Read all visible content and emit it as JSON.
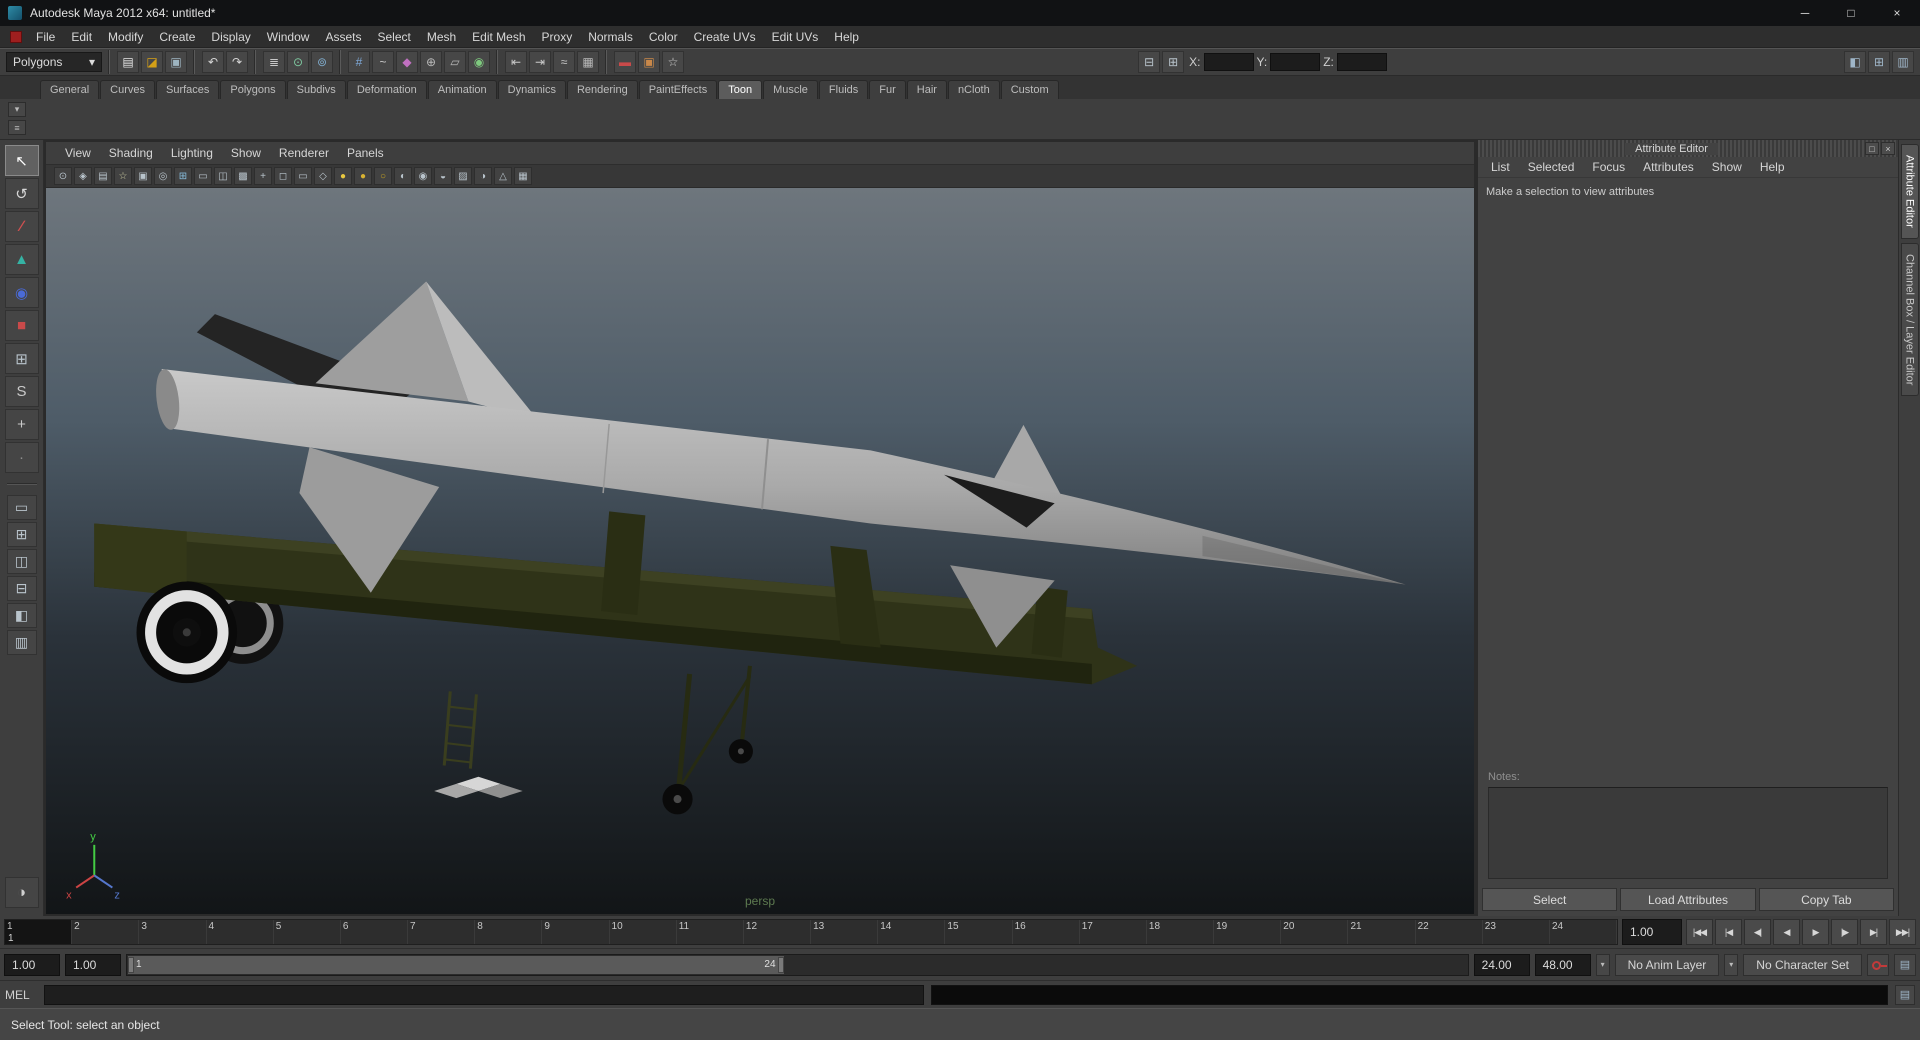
{
  "window": {
    "title": "Autodesk Maya 2012 x64: untitled*",
    "controls": {
      "minimize": "─",
      "maximize": "□",
      "close": "×"
    }
  },
  "menu_bar": {
    "items": [
      {
        "label": "File",
        "name": "menu-file"
      },
      {
        "label": "Edit",
        "name": "menu-edit"
      },
      {
        "label": "Modify",
        "name": "menu-modify"
      },
      {
        "label": "Create",
        "name": "menu-create"
      },
      {
        "label": "Display",
        "name": "menu-display"
      },
      {
        "label": "Window",
        "name": "menu-window"
      },
      {
        "label": "Assets",
        "name": "menu-assets"
      },
      {
        "label": "Select",
        "name": "menu-select"
      },
      {
        "label": "Mesh",
        "name": "menu-mesh"
      },
      {
        "label": "Edit Mesh",
        "name": "menu-edit-mesh"
      },
      {
        "label": "Proxy",
        "name": "menu-proxy"
      },
      {
        "label": "Normals",
        "name": "menu-normals"
      },
      {
        "label": "Color",
        "name": "menu-color"
      },
      {
        "label": "Create UVs",
        "name": "menu-create-uvs"
      },
      {
        "label": "Edit UVs",
        "name": "menu-edit-uvs"
      },
      {
        "label": "Help",
        "name": "menu-help"
      }
    ]
  },
  "status_line": {
    "mode": "Polygons",
    "dropdown_arrow": "▾",
    "file_icons": [
      {
        "name": "new-scene-icon",
        "glyph": "▤",
        "css": "color:#e4e4e4"
      },
      {
        "name": "open-scene-icon",
        "glyph": "◪",
        "css": "color:#d4a017"
      },
      {
        "name": "save-scene-icon",
        "glyph": "▣",
        "css": "color:#9db4c0"
      }
    ],
    "undo_icons": [
      {
        "name": "undo-icon",
        "glyph": "↶",
        "css": "color:#d6d6d6"
      },
      {
        "name": "redo-icon",
        "glyph": "↷",
        "css": "color:#d6d6d6"
      }
    ],
    "select_icons": [
      {
        "name": "select-hierarchy-icon",
        "glyph": "≣",
        "css": "color:#c9c9c9"
      },
      {
        "name": "select-object-icon",
        "glyph": "⊙",
        "css": "color:#7ec9a0"
      },
      {
        "name": "select-component-icon",
        "glyph": "⊚",
        "css": "color:#7ea9c9"
      }
    ],
    "snap_icons": [
      {
        "name": "snap-to-grid-icon",
        "glyph": "#",
        "css": "color:#7ea9d9"
      },
      {
        "name": "snap-to-curve-icon",
        "glyph": "~",
        "css": "color:#c9c9c9"
      },
      {
        "name": "snap-to-point-icon",
        "glyph": "◆",
        "css": "color:#c070c0"
      },
      {
        "name": "snap-to-projected-center-icon",
        "glyph": "⊕",
        "css": "color:#b9b9b9"
      },
      {
        "name": "snap-to-view-plane-icon",
        "glyph": "▱",
        "css": "color:#b9b9b9"
      },
      {
        "name": "make-live-icon",
        "glyph": "◉",
        "css": "color:#7ec97e"
      }
    ],
    "history_icons": [
      {
        "name": "input-connections-icon",
        "glyph": "⇤",
        "css": "color:#c9c9c9"
      },
      {
        "name": "output-connections-icon",
        "glyph": "⇥",
        "css": "color:#c9c9c9"
      },
      {
        "name": "construction-history-icon",
        "glyph": "≈",
        "css": "color:#c9c9c9"
      },
      {
        "name": "hypershade-icon",
        "glyph": "▦",
        "css": "color:#b9b9b9"
      }
    ],
    "render_icons": [
      {
        "name": "render-current-frame-icon",
        "glyph": "▬",
        "css": "color:#c94a4a"
      },
      {
        "name": "ipr-render-icon",
        "glyph": "▣",
        "css": "color:#c9884a"
      },
      {
        "name": "render-settings-icon",
        "glyph": "☆",
        "css": "color:#d6d6d6"
      }
    ],
    "mask_icons": [
      {
        "name": "selection-mask-icon",
        "glyph": "⊟",
        "css": "color:#b9c4cc"
      },
      {
        "name": "input-field-mode-icon",
        "glyph": "⊞",
        "css": "color:#b9c4cc"
      }
    ],
    "coords": {
      "x_label": "X:",
      "y_label": "Y:",
      "z_label": "Z:",
      "x_value": "",
      "y_value": "",
      "z_value": ""
    },
    "layout_icons": [
      {
        "name": "show-hide-attribute-editor-icon",
        "glyph": "◧",
        "css": "color:#9fb6c9"
      },
      {
        "name": "show-hide-tool-settings-icon",
        "glyph": "⊞",
        "css": "color:#9fb6c9"
      },
      {
        "name": "show-hide-channel-box-icon",
        "glyph": "▥",
        "css": "color:#9fb6c9"
      }
    ]
  },
  "shelf": {
    "active_tab": "Toon",
    "tabs": [
      {
        "label": "General",
        "name": "shelf-tab-general"
      },
      {
        "label": "Curves",
        "name": "shelf-tab-curves"
      },
      {
        "label": "Surfaces",
        "name": "shelf-tab-surfaces"
      },
      {
        "label": "Polygons",
        "name": "shelf-tab-polygons"
      },
      {
        "label": "Subdivs",
        "name": "shelf-tab-subdivs"
      },
      {
        "label": "Deformation",
        "name": "shelf-tab-deformation"
      },
      {
        "label": "Animation",
        "name": "shelf-tab-animation"
      },
      {
        "label": "Dynamics",
        "name": "shelf-tab-dynamics"
      },
      {
        "label": "Rendering",
        "name": "shelf-tab-rendering"
      },
      {
        "label": "PaintEffects",
        "name": "shelf-tab-painteffects"
      },
      {
        "label": "Toon",
        "name": "shelf-tab-toon"
      },
      {
        "label": "Muscle",
        "name": "shelf-tab-muscle"
      },
      {
        "label": "Fluids",
        "name": "shelf-tab-fluids"
      },
      {
        "label": "Fur",
        "name": "shelf-tab-fur"
      },
      {
        "label": "Hair",
        "name": "shelf-tab-hair"
      },
      {
        "label": "nCloth",
        "name": "shelf-tab-ncloth"
      },
      {
        "label": "Custom",
        "name": "shelf-tab-custom"
      }
    ],
    "side_buttons": [
      {
        "name": "shelf-tab-selector-icon",
        "glyph": "▾"
      },
      {
        "name": "shelf-menu-icon",
        "glyph": "≡"
      }
    ],
    "icons": [
      {
        "name": "toon-shelf-white-sphere-icon",
        "css": "background:radial-gradient(circle at 35% 30%, #ffffff, #c6c6c6)"
      },
      {
        "name": "toon-shelf-light-gray-sphere-icon",
        "css": "background:radial-gradient(circle at 35% 30%, #f0f0f0, #8e8e8e)"
      },
      {
        "name": "toon-shelf-gray-sphere-icon",
        "css": "background:radial-gradient(circle at 35% 30%, #d8d8d8, #5e5e5e)"
      },
      {
        "name": "toon-shelf-red-sphere-brush-icon",
        "css": "background:radial-gradient(circle at 35% 30%, #e84040, #7c0f0f)",
        "overlay_css": "background:#1c1c1c"
      },
      {
        "name": "toon-shelf-white-circle-icon",
        "css": "background:radial-gradient(circle at 40% 35%, #ffffff, #e4e4e4);border-color:#8e8e8e"
      },
      {
        "name": "toon-shelf-dark-circle-icon",
        "css": "background:radial-gradient(circle at 40% 35%, #6e6e6e, #363636)"
      },
      {
        "name": "toon-shelf-red-sphere-brush-2-icon",
        "css": "background:radial-gradient(circle at 35% 30%, #e05050, #8c1616)",
        "overlay_css": "background:#101010"
      },
      {
        "name": "toon-shelf-black-ring-icon",
        "css": "background:radial-gradient(circle at 40% 35%, #3c3c3c, #101010);border-color:#cfcfcf"
      },
      {
        "name": "toon-shelf-black-ring-thick-icon",
        "css": "background:radial-gradient(circle at 40% 35%, #303030, #0a0a0a);border-color:#e8e8e8"
      },
      {
        "name": "toon-shelf-purple-sphere-brush-icon",
        "css": "background:radial-gradient(circle at 35% 30%, #b070d8, #56287c)",
        "overlay_css": "background:#e8e8e8"
      },
      {
        "name": "toon-shelf-blue-sphere-brush-icon",
        "css": "background:radial-gradient(circle at 35% 30%, #70a0e0, #26457c)",
        "overlay_css": "background:#f0f0f0"
      },
      {
        "name": "toon-shelf-barrel-icon",
        "css": "background:linear-gradient(180deg,#9ab0c0,#5a7080);border-radius:5px"
      },
      {
        "name": "toon-shelf-purple-spheres-icon",
        "css": "background:radial-gradient(circle at 35% 30%, #c090e0, #663a94)"
      },
      {
        "name": "toon-shelf-outline-brush-yellow-icon",
        "css": "background:radial-gradient(circle at 40% 35%, #5a5a5a, #2e2e2e);border-color:#d8c050",
        "overlay_css": "background:#c93030"
      },
      {
        "name": "toon-shelf-outline-brush-1-icon",
        "css": "background:radial-gradient(circle at 35% 30%, #ececec, #9c9c9c)",
        "overlay_css": "background:#c93030"
      },
      {
        "name": "toon-shelf-outline-brush-2-icon",
        "css": "background:radial-gradient(circle at 35% 30%, #d6d6d6, #848484)",
        "overlay_css": "background:#c93030"
      },
      {
        "name": "toon-shelf-outline-brush-3-icon",
        "css": "background:radial-gradient(circle at 35% 30%, #c6c6c6, #787878)",
        "overlay_css": "background:#b02020"
      },
      {
        "name": "toon-shelf-outline-brush-4-icon",
        "css": "background:radial-gradient(circle at 35% 30%, #ddd4a0, #948428)",
        "overlay_css": "background:#b02020"
      }
    ]
  },
  "toolbox": {
    "active_tool": "select-tool",
    "tools": [
      {
        "name": "select-tool",
        "glyph": "↖",
        "css": "color:#ffffff"
      },
      {
        "name": "lasso-tool",
        "glyph": "↺",
        "css": "color:#d6d6d6"
      },
      {
        "name": "paint-selection-tool",
        "glyph": "∕",
        "css": "color:#d05050;font-weight:bold"
      },
      {
        "name": "move-tool",
        "glyph": "▲",
        "css": "color:#35b3a4"
      },
      {
        "name": "rotate-tool",
        "glyph": "◉",
        "css": "color:#4a6ad6"
      },
      {
        "name": "scale-tool",
        "glyph": "■",
        "css": "color:#c94a4a"
      },
      {
        "name": "universal-manipulator-tool",
        "glyph": "⊞",
        "css": "color:#b9c4cc"
      },
      {
        "name": "soft-modification-tool",
        "glyph": "S",
        "css": "color:#c9c9c9"
      },
      {
        "name": "show-manipulator-tool",
        "glyph": "+",
        "css": "color:#c9c9c9"
      },
      {
        "name": "last-tool-used",
        "glyph": "·",
        "css": "color:#8e8e8e"
      }
    ],
    "layouts": [
      {
        "name": "layout-single-pane-icon",
        "glyph": "▭"
      },
      {
        "name": "layout-four-panes-icon",
        "glyph": "⊞"
      },
      {
        "name": "layout-two-panes-side-icon",
        "glyph": "◫"
      },
      {
        "name": "layout-two-panes-stacked-icon",
        "glyph": "⊟"
      },
      {
        "name": "layout-persp-outliner-icon",
        "glyph": "◧"
      },
      {
        "name": "layout-three-panes-icon",
        "glyph": "▥"
      }
    ],
    "bottom_icon": {
      "name": "panel-layout-sphere-icon",
      "glyph": "◑"
    }
  },
  "panel_menu": {
    "items": [
      {
        "label": "View",
        "name": "panel-menu-view"
      },
      {
        "label": "Shading",
        "name": "panel-menu-shading"
      },
      {
        "label": "Lighting",
        "name": "panel-menu-lighting"
      },
      {
        "label": "Show",
        "name": "panel-menu-show"
      },
      {
        "label": "Renderer",
        "name": "panel-menu-renderer"
      },
      {
        "label": "Panels",
        "name": "panel-menu-panels"
      }
    ],
    "toolbar_icons": [
      {
        "name": "select-camera-icon",
        "glyph": "⊙",
        "css": "color:#b9c4cc"
      },
      {
        "name": "lock-camera-icon",
        "glyph": "◈",
        "css": "color:#b9c4cc"
      },
      {
        "name": "camera-attributes-icon",
        "glyph": "▤",
        "css": "color:#b9c4cc"
      },
      {
        "name": "bookmarks-icon",
        "glyph": "☆",
        "css": "color:#c9c9a0"
      },
      {
        "name": "image-plane-icon",
        "glyph": "▣",
        "css": "color:#b9c4cc"
      },
      {
        "name": "two-d-pan-zoom-icon",
        "glyph": "◎",
        "css": "color:#b9c4cc"
      },
      {
        "name": "grid-toggle-icon",
        "glyph": "⊞",
        "css": "color:#89c0e0"
      },
      {
        "name": "film-gate-icon",
        "glyph": "▭",
        "css": "color:#b9c4cc"
      },
      {
        "name": "resolution-gate-icon",
        "glyph": "◫",
        "css": "color:#b9c4cc"
      },
      {
        "name": "gate-mask-icon",
        "glyph": "▩",
        "css": "color:#b9c4cc"
      },
      {
        "name": "field-chart-icon",
        "glyph": "+",
        "css": "color:#b9c4cc"
      },
      {
        "name": "safe-action-icon",
        "glyph": "◻",
        "css": "color:#b9c4cc"
      },
      {
        "name": "safe-title-icon",
        "glyph": "▭",
        "css": "color:#b9c4cc"
      },
      {
        "name": "frame-all-icon",
        "glyph": "◇",
        "css": "color:#b9c4cc"
      },
      {
        "name": "use-all-lights-icon",
        "glyph": "●",
        "css": "color:#e8c840"
      },
      {
        "name": "use-default-lighting-icon",
        "glyph": "●",
        "css": "color:#d8b232"
      },
      {
        "name": "use-no-lights-icon",
        "glyph": "○",
        "css": "color:#c8a422"
      },
      {
        "name": "shadows-toggle-icon",
        "glyph": "◐",
        "css": "color:#b9c4cc"
      },
      {
        "name": "wireframe-mode-icon",
        "glyph": "◉",
        "css": "color:#b9c4cc"
      },
      {
        "name": "shaded-mode-icon",
        "glyph": "◒",
        "css": "color:#b9c4cc"
      },
      {
        "name": "textured-mode-icon",
        "glyph": "▨",
        "css": "color:#b9c4cc"
      },
      {
        "name": "xray-mode-icon",
        "glyph": "◑",
        "css": "color:#b9c4cc"
      },
      {
        "name": "isolate-select-icon",
        "glyph": "△",
        "css": "color:#b9c4cc"
      },
      {
        "name": "multisample-icon",
        "glyph": "▦",
        "css": "color:#b9c4cc"
      }
    ]
  },
  "viewport": {
    "camera_label": "persp",
    "axis_labels": {
      "x": "x",
      "y": "y",
      "z": "z"
    },
    "scene_colors": {
      "sky_top": "#6e767d",
      "sky_mid": "#4e5c68",
      "sky_low": "#2a323a",
      "sky_bottom": "#121517",
      "missile_light": "#c9c9c9",
      "missile_mid": "#a9a9a9",
      "missile_dark": "#7f7f7f",
      "fin_dark": "#242424",
      "trailer_olive": "#2f3318",
      "trailer_olive_light": "#3d4122",
      "trailer_dark": "#20240f",
      "tire_black": "#0a0a0a",
      "rim_white": "#e2e2e2",
      "axis_x": "#cc4444",
      "axis_y": "#44cc44",
      "axis_z": "#5577cc"
    }
  },
  "attribute_editor": {
    "title": "Attribute Editor",
    "header_icons": [
      {
        "name": "ae-float-icon",
        "glyph": "□"
      },
      {
        "name": "ae-close-icon",
        "glyph": "×"
      }
    ],
    "menu": [
      {
        "label": "List",
        "name": "ae-menu-list"
      },
      {
        "label": "Selected",
        "name": "ae-menu-selected"
      },
      {
        "label": "Focus",
        "name": "ae-menu-focus"
      },
      {
        "label": "Attributes",
        "name": "ae-menu-attributes"
      },
      {
        "label": "Show",
        "name": "ae-menu-show"
      },
      {
        "label": "Help",
        "name": "ae-menu-help"
      }
    ],
    "message": "Make a selection to view attributes",
    "notes_label": "Notes:",
    "buttons": [
      {
        "label": "Select",
        "name": "ae-select-button"
      },
      {
        "label": "Load Attributes",
        "name": "ae-load-attributes-button"
      },
      {
        "label": "Copy Tab",
        "name": "ae-copy-tab-button"
      }
    ]
  },
  "side_tabs": [
    {
      "label": "Attribute Editor",
      "name": "side-tab-attribute-editor",
      "active": "Attribute Editor"
    },
    {
      "label": "Channel Box / Layer Editor",
      "name": "side-tab-channel-box"
    }
  ],
  "timeline": {
    "ticks": [
      "1",
      "2",
      "3",
      "4",
      "5",
      "6",
      "7",
      "8",
      "9",
      "10",
      "11",
      "12",
      "13",
      "14",
      "15",
      "16",
      "17",
      "18",
      "19",
      "20",
      "21",
      "22",
      "23",
      "24"
    ],
    "current_frame": "1",
    "current_time": "1.00",
    "playback": [
      {
        "name": "go-to-playback-start-button",
        "glyph": "|◀◀"
      },
      {
        "name": "step-back-one-frame-button",
        "glyph": "|◀"
      },
      {
        "name": "step-back-one-key-button",
        "glyph": "◀|"
      },
      {
        "name": "play-backwards-button",
        "glyph": "◀"
      },
      {
        "name": "play-forwards-button",
        "glyph": "▶"
      },
      {
        "name": "step-forward-one-key-button",
        "glyph": "|▶"
      },
      {
        "name": "step-forward-one-frame-button",
        "glyph": "▶|"
      },
      {
        "name": "go-to-playback-end-button",
        "glyph": "▶▶|"
      }
    ]
  },
  "range_slider": {
    "anim_start": "1.00",
    "playback_start": "1.00",
    "bar_start_label": "1",
    "bar_end_label": "24",
    "playback_end": "24.00",
    "anim_end": "48.00",
    "dropdown_arrow": "▾",
    "anim_layer": "No Anim Layer",
    "character_set": "No Character Set"
  },
  "command_line": {
    "label": "MEL",
    "input_value": "",
    "result_value": "",
    "icon_glyph": "▤"
  },
  "help_line": {
    "text": "Select Tool: select an object"
  }
}
